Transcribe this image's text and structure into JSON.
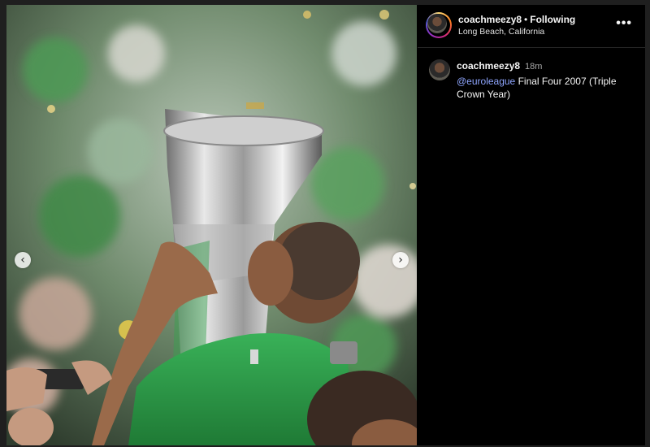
{
  "post": {
    "username": "coachmeezy8",
    "separator": "•",
    "follow_status": "Following",
    "location": "Long Beach, California",
    "more_label": "•••"
  },
  "caption": {
    "username": "coachmeezy8",
    "time": "18m",
    "mention": "@euroleague",
    "text": "Final Four 2007 (Triple Crown Year)"
  },
  "carousel": {
    "prev_label": "‹",
    "next_label": "›"
  },
  "colors": {
    "mention": "#8fa6ff",
    "jersey": "#2e9e48",
    "panel_bg": "#000000"
  }
}
